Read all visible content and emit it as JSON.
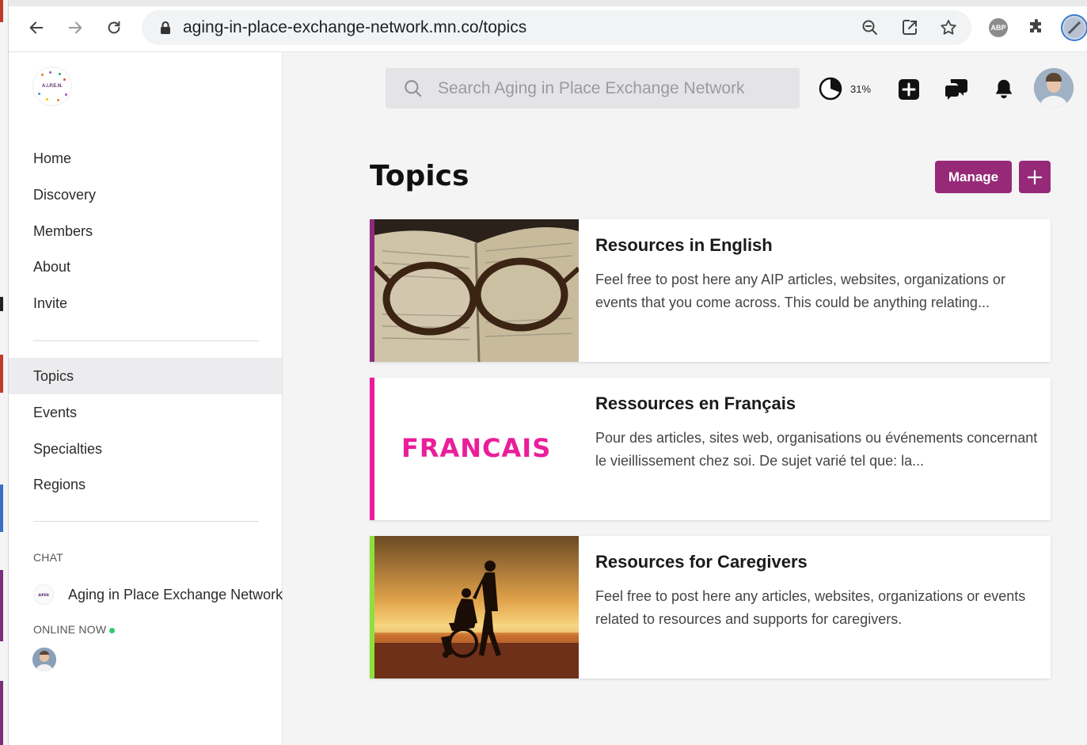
{
  "browser": {
    "url": "aging-in-place-exchange-network.mn.co/topics",
    "extension_abp_label": "ABP"
  },
  "sidebar": {
    "logo_text": "A.I.P.E.N.",
    "nav_primary": [
      {
        "label": "Home"
      },
      {
        "label": "Discovery"
      },
      {
        "label": "Members"
      },
      {
        "label": "About"
      },
      {
        "label": "Invite"
      }
    ],
    "nav_secondary": [
      {
        "label": "Topics",
        "active": true
      },
      {
        "label": "Events"
      },
      {
        "label": "Specialties"
      },
      {
        "label": "Regions"
      }
    ],
    "chat_label": "CHAT",
    "chat_name": "Aging in Place Exchange Network",
    "online_label": "ONLINE NOW"
  },
  "header": {
    "search_placeholder": "Search Aging in Place Exchange Network",
    "progress_percent": "31%",
    "progress_value": 0.31
  },
  "main": {
    "title": "Topics",
    "manage_label": "Manage"
  },
  "topics": [
    {
      "title": "Resources in English",
      "description": "Feel free to post here any AIP articles, websites, organizations or events that you come across. This could be anything relating...",
      "accent": "#8e2a7e"
    },
    {
      "title": "Ressources en Français",
      "description": "Pour des articles, sites web, organisations ou événements concernant le vieillissement chez soi. De sujet varié tel que: la...",
      "accent": "#ea1e9a",
      "image_word": "FRANCAIS"
    },
    {
      "title": "Resources for Caregivers",
      "description": "Feel free to post here any articles, websites, organizations or events related to resources and supports for caregivers.",
      "accent": "#8ee03a"
    }
  ],
  "colors": {
    "brand": "#962a78",
    "active_nav": "#ececef",
    "main_bg": "#f4f4f5"
  }
}
